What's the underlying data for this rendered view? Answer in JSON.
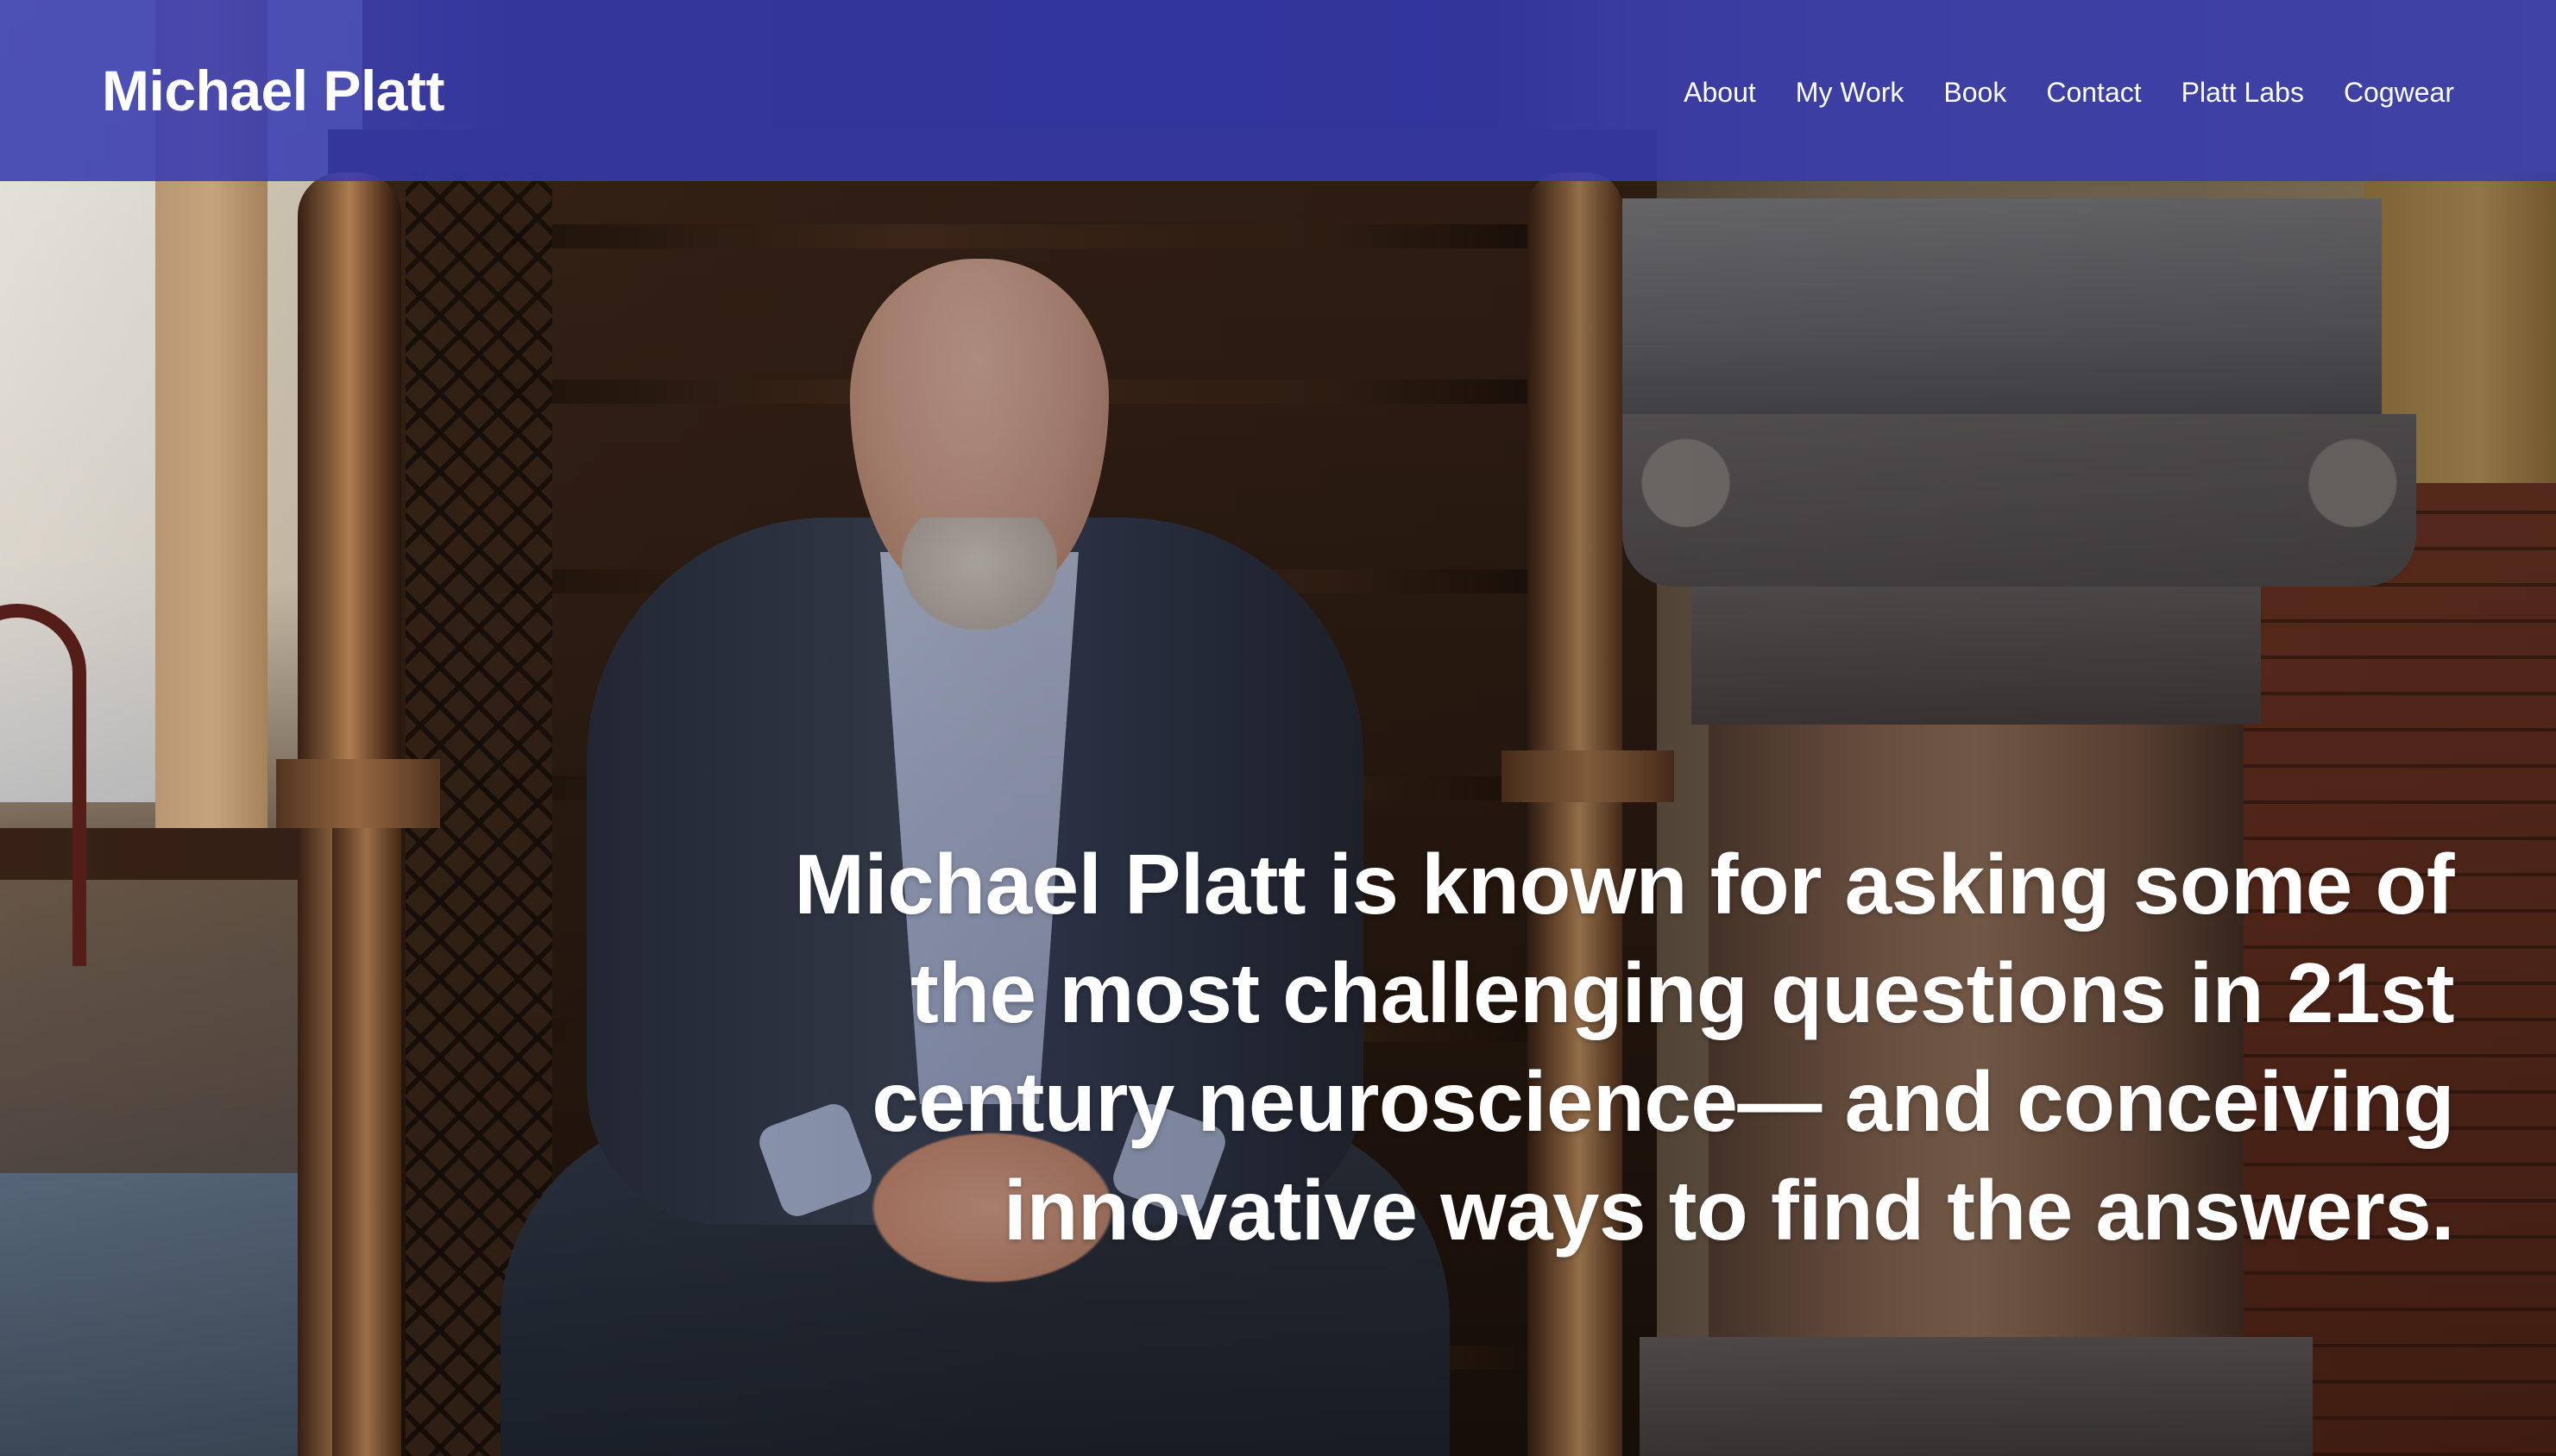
{
  "header": {
    "site_title": "Michael Platt",
    "background_color": "#363ab2",
    "nav": [
      {
        "label": "About"
      },
      {
        "label": "My Work"
      },
      {
        "label": "Book"
      },
      {
        "label": "Contact"
      },
      {
        "label": "Platt Labs"
      },
      {
        "label": "Cogwear"
      }
    ]
  },
  "hero": {
    "headline": "Michael Platt is known for asking some of the most challenging questions in 21st century neuroscience— and conceiving innovative ways to find the  answers.",
    "text_color": "#ffffff"
  }
}
